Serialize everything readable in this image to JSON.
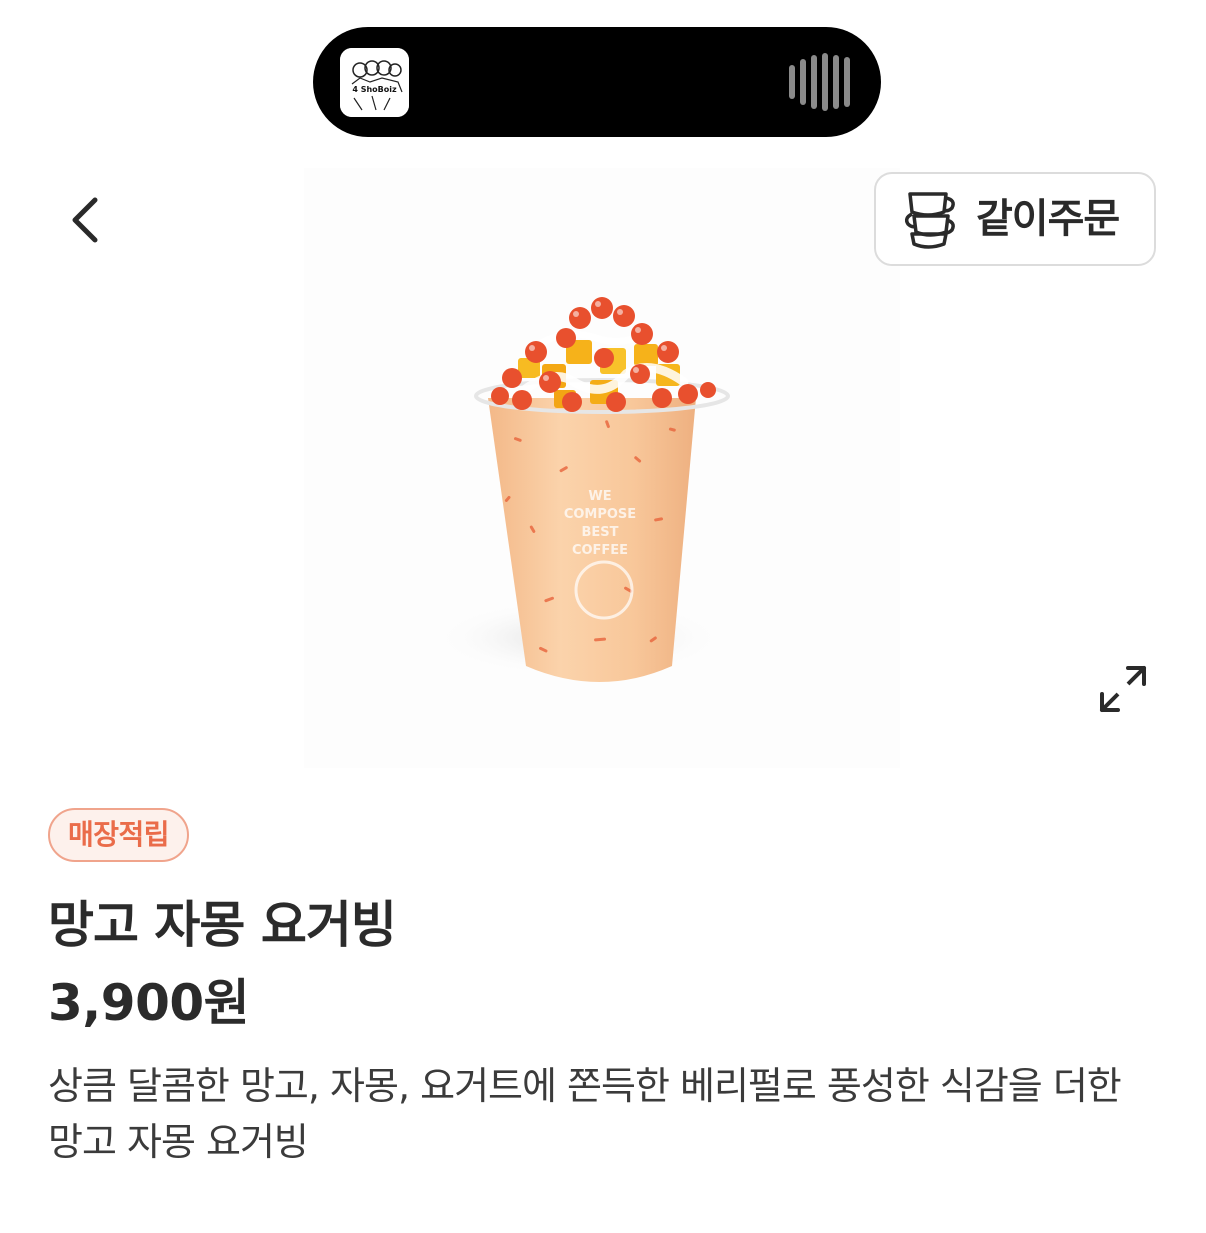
{
  "now_playing": {
    "album_art_text": "4 ShoBoiz"
  },
  "header": {
    "group_order_label": "같이주문"
  },
  "product": {
    "badge": "매장적립",
    "name": "망고 자몽 요거빙",
    "price": "3,900원",
    "description": "상큼 달콤한 망고, 자몽, 요거트에 쫀득한 베리펄로 풍성한 식감을 더한 망고 자몽 요거빙",
    "cup_print": [
      "WE",
      "COMPOSE",
      "BEST",
      "COFFEE"
    ]
  },
  "colors": {
    "accent": "#ea6c4a",
    "badge_bg": "#fdf1ec",
    "badge_border": "#f0a48c",
    "drink": "#f8c79a",
    "mango": "#f6b21a",
    "pearl": "#e8502e"
  },
  "icons": {
    "back": "chevron-left-icon",
    "group_order": "stacked-cups-icon",
    "expand": "expand-arrows-icon",
    "waveform": "waveform-icon"
  }
}
